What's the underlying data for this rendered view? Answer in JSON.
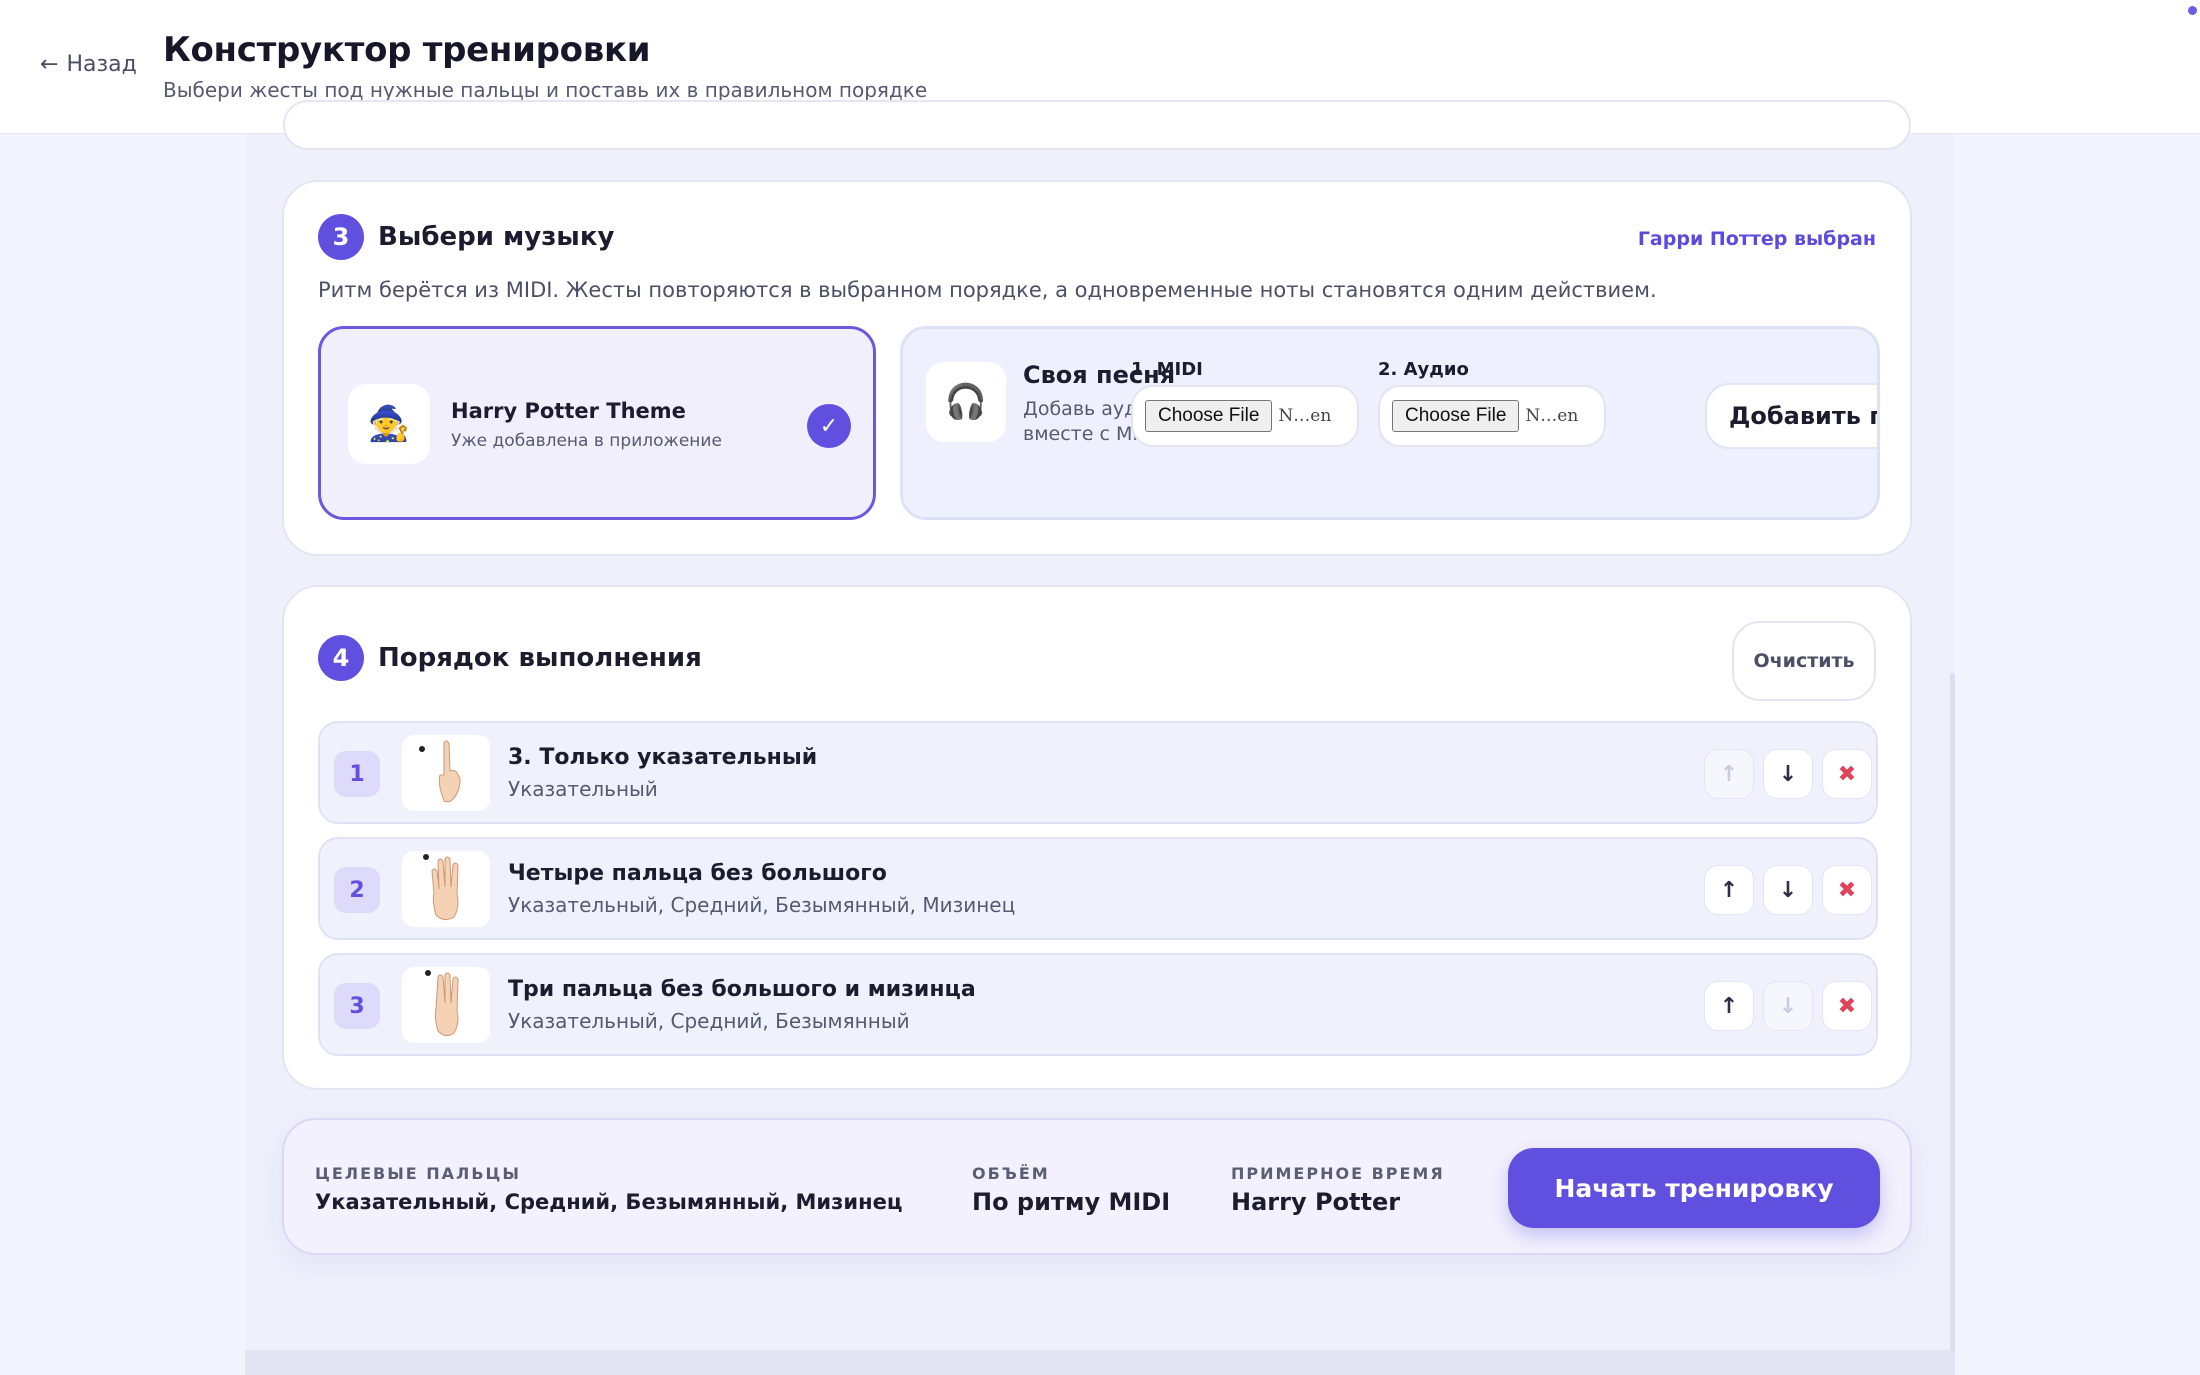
{
  "header": {
    "back_label": "Назад",
    "title": "Конструктор тренировки",
    "subtitle": "Выбери жесты под нужные пальцы и поставь их в правильном порядке"
  },
  "music": {
    "step": "3",
    "title": "Выбери музыку",
    "selected_tag": "Гарри Поттер выбран",
    "description": "Ритм берётся из MIDI. Жесты повторяются в выбранном порядке, а одновременные ноты становятся одним действием.",
    "song": {
      "emoji": "🧙",
      "name": "Harry Potter Theme",
      "sub": "Уже добавлена в приложение",
      "check": "✓"
    },
    "custom": {
      "icon": "🎧",
      "title": "Своя песня",
      "sub": "Добавь аудио вместе с MIDI",
      "midi_label": "1. MIDI",
      "audio_label": "2. Аудио",
      "choose_file": "Choose File",
      "no_file": "N…en",
      "add_button": "Добавить песню"
    }
  },
  "order": {
    "step": "4",
    "title": "Порядок выполнения",
    "clear_label": "Очистить",
    "rows": [
      {
        "num": "1",
        "title": "3. Только указательный",
        "sub": "Указательный",
        "up_disabled": true,
        "down_disabled": false
      },
      {
        "num": "2",
        "title": "Четыре пальца без большого",
        "sub": "Указательный, Средний, Безымянный, Мизинец",
        "up_disabled": false,
        "down_disabled": false
      },
      {
        "num": "3",
        "title": "Три пальца без большого и мизинца",
        "sub": "Указательный, Средний, Безымянный",
        "up_disabled": false,
        "down_disabled": true
      }
    ],
    "icons": {
      "up": "↑",
      "down": "↓",
      "remove": "✖"
    }
  },
  "summary": {
    "fingers_label": "ЦЕЛЕВЫЕ ПАЛЬЦЫ",
    "fingers_value": "Указательный, Средний, Безымянный, Мизинец",
    "volume_label": "ОБЪЁМ",
    "volume_value": "По ритму MIDI",
    "time_label": "ПРИМЕРНОЕ ВРЕМЯ",
    "time_value": "Harry Potter",
    "start_label": "Начать тренировку"
  },
  "colors": {
    "accent": "#6150e0",
    "remove": "#e0435a",
    "background": "#f3f4fd"
  }
}
